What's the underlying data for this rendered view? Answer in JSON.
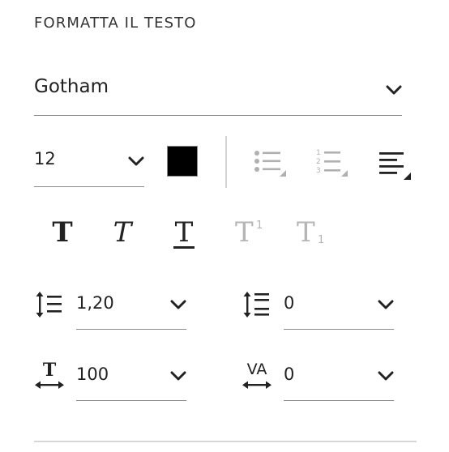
{
  "panel": {
    "title": "FORMATTA IL TESTO"
  },
  "font": {
    "family": "Gotham"
  },
  "size": {
    "value": "12"
  },
  "color": {
    "swatch": "#000000"
  },
  "icons": {
    "bullet_list": "bulleted-list-icon",
    "numbered_list": "numbered-list-icon",
    "align": "align-left-icon"
  },
  "style_buttons": [
    {
      "name": "bold",
      "glyph": "T",
      "enabled": true
    },
    {
      "name": "italic",
      "glyph": "T",
      "enabled": true
    },
    {
      "name": "underline",
      "glyph": "T",
      "enabled": true
    },
    {
      "name": "superscript",
      "glyph": "T",
      "sup": "1",
      "enabled": false
    },
    {
      "name": "subscript",
      "glyph": "T",
      "sub": "1",
      "enabled": false
    }
  ],
  "line_spacing": {
    "value": "1,20"
  },
  "paragraph_spacing": {
    "value": "0"
  },
  "horizontal_scale": {
    "value": "100"
  },
  "tracking": {
    "label": "VA",
    "value": "0"
  }
}
